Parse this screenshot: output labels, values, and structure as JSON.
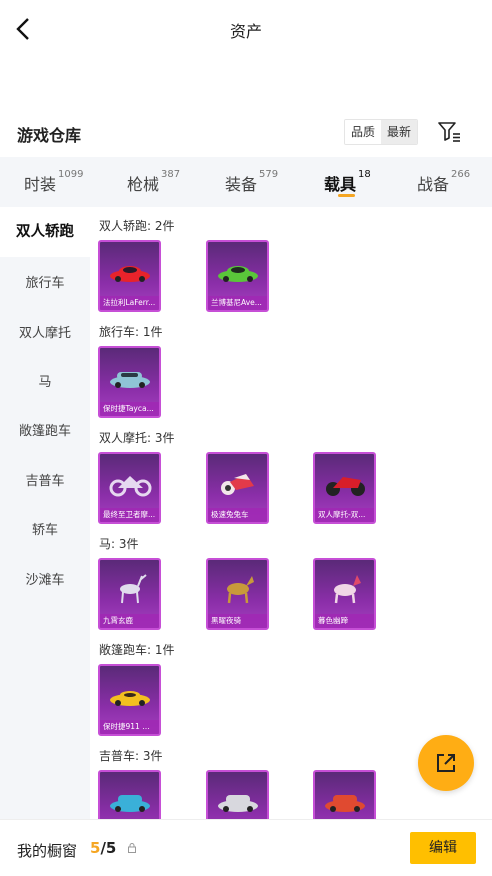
{
  "header": {
    "title": "资产"
  },
  "section": {
    "title": "游戏仓库"
  },
  "sort": {
    "options": [
      "品质",
      "最新"
    ],
    "active": "最新"
  },
  "tabs": [
    {
      "label": "时装",
      "count": "1099"
    },
    {
      "label": "枪械",
      "count": "387"
    },
    {
      "label": "装备",
      "count": "579"
    },
    {
      "label": "载具",
      "count": "18"
    },
    {
      "label": "战备",
      "count": "266"
    }
  ],
  "active_tab": "载具",
  "sidebar": {
    "items": [
      "双人轿跑",
      "旅行车",
      "双人摩托",
      "马",
      "敞篷跑车",
      "吉普车",
      "轿车",
      "沙滩车"
    ],
    "active": "双人轿跑"
  },
  "groups": [
    {
      "label": "双人轿跑: 2件",
      "items": [
        {
          "name": "法拉利LaFerr...",
          "icon": "red-sports-car",
          "color": "#e8232b"
        },
        {
          "name": "兰博基尼Ave...",
          "icon": "green-sports-car",
          "color": "#5ac63a"
        }
      ]
    },
    {
      "label": "旅行车: 1件",
      "items": [
        {
          "name": "保时捷Tayca...",
          "icon": "blue-wagon-car",
          "color": "#8fc4d6"
        }
      ]
    },
    {
      "label": "双人摩托: 3件",
      "items": [
        {
          "name": "最终至卫者摩...",
          "icon": "white-motorcycle",
          "color": "#e6d8f0"
        },
        {
          "name": "极速兔兔车",
          "icon": "pink-motorcycle",
          "color": "#f2e6ea"
        },
        {
          "name": "双人摩托-双...",
          "icon": "red-motorcycle",
          "color": "#d81e2a"
        }
      ]
    },
    {
      "label": "马: 3件",
      "items": [
        {
          "name": "九霄玄鹿",
          "icon": "silver-deer",
          "color": "#e0dced"
        },
        {
          "name": "黑曜夜骑",
          "icon": "gold-horse",
          "color": "#c89a3a"
        },
        {
          "name": "暮色幽蹄",
          "icon": "pink-horse",
          "color": "#f0d6e6"
        }
      ]
    },
    {
      "label": "敞篷跑车: 1件",
      "items": [
        {
          "name": "保时捷911 敞...",
          "icon": "yellow-convertible",
          "color": "#f3c020"
        }
      ]
    },
    {
      "label": "吉普车: 3件",
      "items": [
        {
          "name": "",
          "icon": "blue-suv",
          "color": "#3ab0d8"
        },
        {
          "name": "",
          "icon": "silver-suv",
          "color": "#d8d8de"
        },
        {
          "name": "",
          "icon": "red-suv",
          "color": "#e04a30"
        }
      ]
    }
  ],
  "footer": {
    "label": "我的橱窗",
    "current": "5",
    "separator": "/",
    "max": "5",
    "edit_label": "编辑"
  },
  "colors": {
    "accent": "#ffbf00",
    "orange": "#f5a623",
    "card_border": "#c64fd6"
  }
}
